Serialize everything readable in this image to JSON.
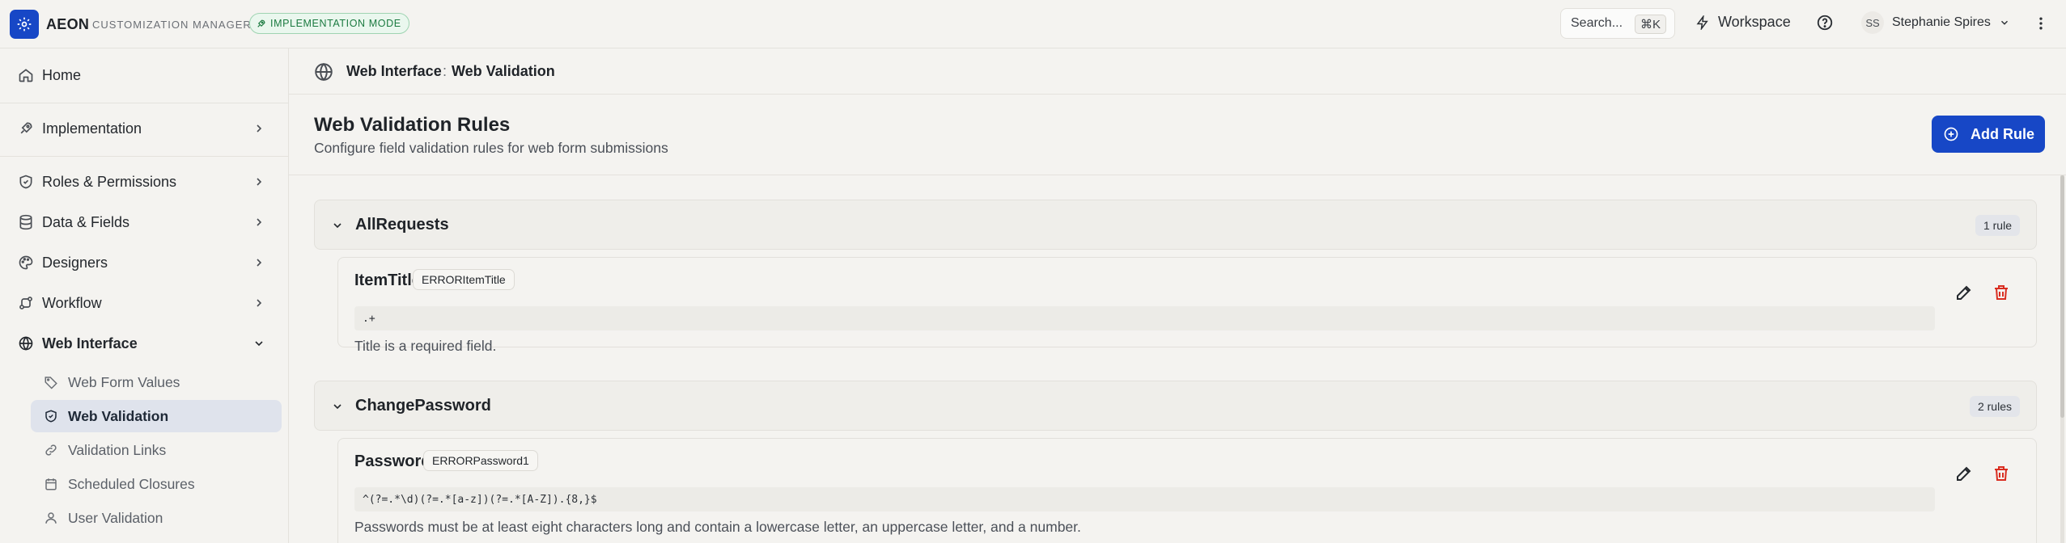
{
  "app": {
    "brand": "AEON",
    "subtitle": "CUSTOMIZATION MANAGER",
    "mode_badge": "IMPLEMENTATION MODE"
  },
  "topbar": {
    "search_label": "Search...",
    "search_shortcut": "⌘K",
    "workspace_label": "Workspace",
    "user_initials": "SS",
    "user_name": "Stephanie Spires"
  },
  "sidebar": {
    "items": [
      {
        "label": "Home",
        "icon": "home-icon"
      },
      {
        "label": "Implementation",
        "icon": "rocket-icon"
      },
      {
        "label": "Roles & Permissions",
        "icon": "shield-icon"
      },
      {
        "label": "Data & Fields",
        "icon": "database-icon"
      },
      {
        "label": "Designers",
        "icon": "palette-icon"
      },
      {
        "label": "Workflow",
        "icon": "workflow-icon"
      },
      {
        "label": "Web Interface",
        "icon": "globe-icon"
      }
    ],
    "sub_items": [
      {
        "label": "Web Form Values",
        "icon": "tag-icon"
      },
      {
        "label": "Web Validation",
        "icon": "shield-check-icon",
        "active": true
      },
      {
        "label": "Validation Links",
        "icon": "link-icon"
      },
      {
        "label": "Scheduled Closures",
        "icon": "calendar-icon"
      },
      {
        "label": "User Validation",
        "icon": "user-icon"
      }
    ]
  },
  "breadcrumb": {
    "parent": "Web Interface",
    "separator": ":",
    "current": "Web Validation"
  },
  "page": {
    "title": "Web Validation Rules",
    "subtitle": "Configure field validation rules for web form submissions",
    "add_button": "Add Rule"
  },
  "groups": [
    {
      "name": "AllRequests",
      "count": "1 rule",
      "rules": [
        {
          "name": "ItemTitle",
          "code": "ERRORItemTitle",
          "regex": ".+",
          "message": "Title is a required field."
        }
      ]
    },
    {
      "name": "ChangePassword",
      "count": "2 rules",
      "rules": [
        {
          "name": "Password1",
          "code": "ERRORPassword1",
          "regex": "^(?=.*\\d)(?=.*[a-z])(?=.*[A-Z]).{8,}$",
          "message": "Passwords must be at least eight characters long and contain a lowercase letter, an uppercase letter, and a number."
        }
      ]
    }
  ],
  "colors": {
    "accent": "#1747c6",
    "delete": "#d92d20",
    "badge_green": "#1b7a40"
  }
}
